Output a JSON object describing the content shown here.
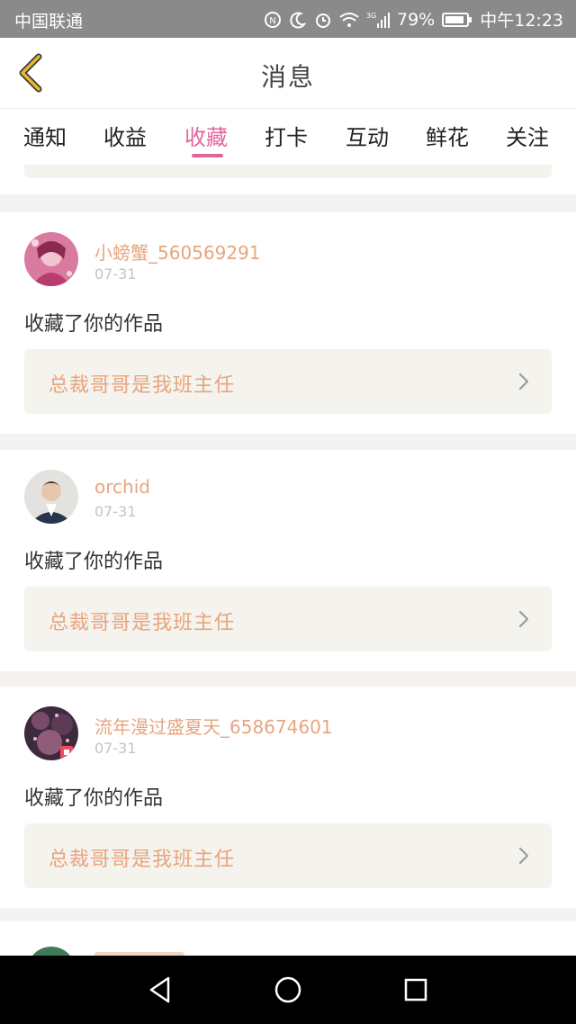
{
  "status_bar": {
    "carrier": "中国联通",
    "network": "3G",
    "battery": "79%",
    "time": "中午12:23"
  },
  "header": {
    "back_icon": "chevron-left-icon",
    "title": "消息"
  },
  "tabs": [
    {
      "label": "通知",
      "active": false
    },
    {
      "label": "收益",
      "active": false
    },
    {
      "label": "收藏",
      "active": true
    },
    {
      "label": "打卡",
      "active": false
    },
    {
      "label": "互动",
      "active": false
    },
    {
      "label": "鲜花",
      "active": false
    },
    {
      "label": "关注",
      "active": false
    }
  ],
  "messages": [
    {
      "username": "小螃蟹_560569291",
      "date": "07-31",
      "action": "收藏了你的作品",
      "work_title": "总裁哥哥是我班主任"
    },
    {
      "username": "orchid",
      "date": "07-31",
      "action": "收藏了你的作品",
      "work_title": "总裁哥哥是我班主任"
    },
    {
      "username": "流年漫过盛夏天_658674601",
      "date": "07-31",
      "action": "收藏了你的作品",
      "work_title": "总裁哥哥是我班主任"
    }
  ],
  "colors": {
    "accent_pink": "#e0679e",
    "username_orange": "#e7a57f",
    "back_icon_yellow": "#e8b92f",
    "work_box_bg": "#f5f3ed"
  },
  "nav_bar": {
    "icons": [
      "back-triangle-icon",
      "home-circle-icon",
      "recents-square-icon"
    ]
  }
}
